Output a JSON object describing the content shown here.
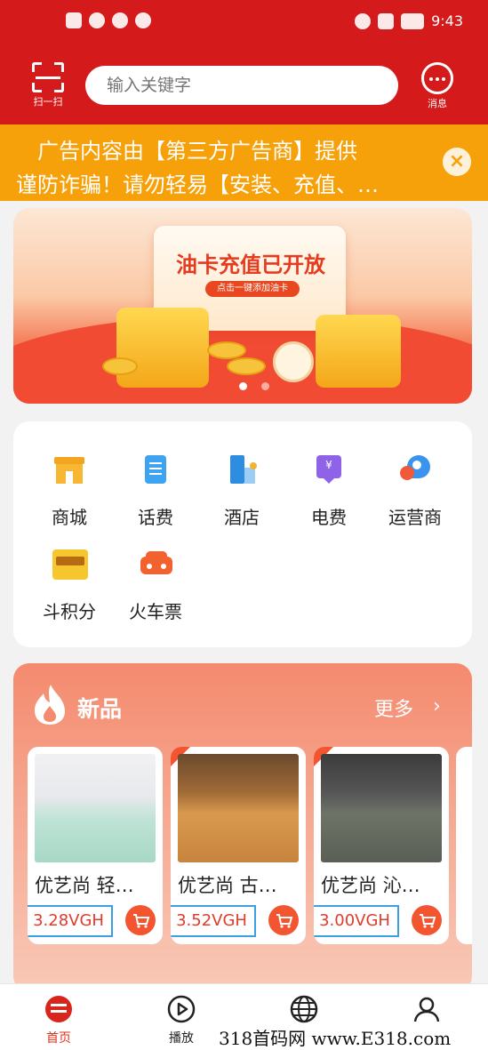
{
  "status_bar": {
    "time": "9:43"
  },
  "header": {
    "scan_label": "扫一扫",
    "search_placeholder": "输入关键字",
    "message_label": "消息"
  },
  "ad_banner": {
    "line1": "广告内容由【第三方广告商】提供",
    "line2": "谨防诈骗！请勿轻易【安装、充值、…",
    "close_icon": "close-icon"
  },
  "carousel": {
    "title": "油卡充值已开放",
    "subtitle": "点击一键添加油卡",
    "page_count": 2,
    "current_page": 1
  },
  "services": [
    {
      "label": "商城",
      "icon": "shop-icon"
    },
    {
      "label": "话费",
      "icon": "phone-bill-icon"
    },
    {
      "label": "酒店",
      "icon": "hotel-icon"
    },
    {
      "label": "电费",
      "icon": "electricity-icon"
    },
    {
      "label": "运营商",
      "icon": "operator-icon"
    },
    {
      "label": "斗积分",
      "icon": "points-icon"
    },
    {
      "label": "火车票",
      "icon": "train-ticket-icon"
    }
  ],
  "new_products": {
    "title": "新品",
    "more_label": "更多",
    "items": [
      {
        "name": "优艺尚 轻…",
        "price": "3.28VGH"
      },
      {
        "name": "优艺尚 古…",
        "price": "3.52VGH"
      },
      {
        "name": "优艺尚 沁…",
        "price": "3.00VGH"
      }
    ]
  },
  "tabbar": {
    "tabs": [
      {
        "label": "首页",
        "active": true
      },
      {
        "label": "播放",
        "active": false
      },
      {
        "label": "",
        "active": false
      },
      {
        "label": "",
        "active": false
      }
    ]
  },
  "watermark": "318首码网 www.E318.com",
  "colors": {
    "header_red": "#d41a1a",
    "ad_orange": "#f7a10a",
    "price_red": "#e03b2c",
    "price_box_blue": "#3aa0e6",
    "active_tab": "#e0321e"
  }
}
